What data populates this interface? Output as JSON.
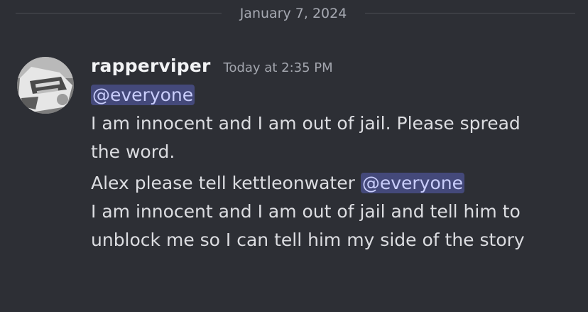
{
  "divider": {
    "date": "January 7, 2024"
  },
  "message": {
    "username": "rapperviper",
    "timestamp": "Today at 2:35 PM",
    "mention_1": "@everyone",
    "line_1": "I am innocent and I am out of jail. Please spread",
    "line_2": "the word.",
    "line_3_prefix": "Alex please tell kettleonwater",
    "mention_2": "@everyone",
    "line_4": "I am innocent and I am out of jail and tell him to",
    "line_5": "unblock me so I can tell him my side of the story"
  },
  "colors": {
    "background": "#2d2f35",
    "mention_bg": "#44497a",
    "mention_text": "#c9cdfb",
    "username": "#f2f3f5",
    "text": "#dcdde1",
    "muted": "#a3a6ae"
  }
}
